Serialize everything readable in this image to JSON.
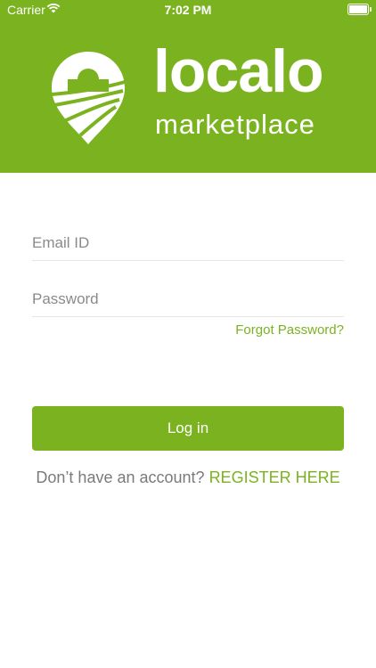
{
  "status_bar": {
    "carrier": "Carrier",
    "time": "7:02 PM"
  },
  "brand": {
    "name": "localo",
    "tagline": "marketplace",
    "logo_icon": "map-pin-fields-icon"
  },
  "form": {
    "email_placeholder": "Email ID",
    "email_value": "",
    "password_placeholder": "Password",
    "password_value": "",
    "forgot_label": "Forgot Password?",
    "login_label": "Log in"
  },
  "register": {
    "prompt": "Don’t have an account?",
    "link_label": "REGISTER HERE"
  },
  "colors": {
    "brand_green": "#7bb320",
    "text_gray": "#7a7a7a"
  }
}
